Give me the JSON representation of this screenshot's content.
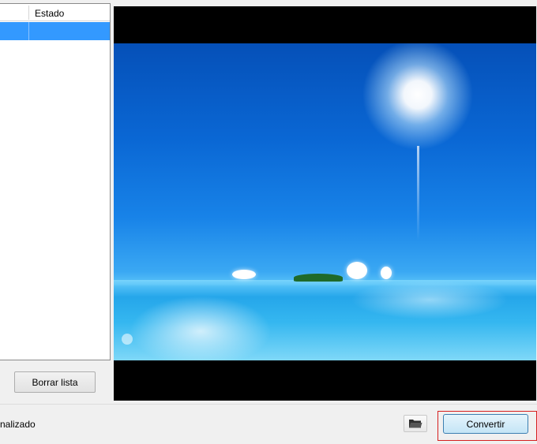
{
  "file_list": {
    "columns": [
      "",
      "Estado"
    ],
    "rows": [
      {
        "name": "",
        "status": ""
      }
    ]
  },
  "buttons": {
    "clear_list": "Borrar lista",
    "convert": "Convertir",
    "open_folder_icon": "folder-icon"
  },
  "status_bar": {
    "text": "nalizado"
  },
  "colors": {
    "selection": "#3399ff",
    "highlight_outline": "#d61f1f",
    "convert_button": "#c4e5f6"
  }
}
